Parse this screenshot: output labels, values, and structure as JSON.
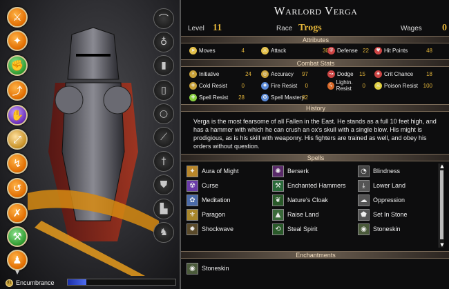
{
  "hero": {
    "name": "Warlord Verga",
    "level_label": "Level",
    "level": "11",
    "race_label": "Race",
    "race": "Trogs",
    "wages_label": "Wages",
    "wages": "0"
  },
  "sections": {
    "attributes": "Attributes",
    "combat": "Combat Stats",
    "history": "History",
    "spells": "Spells",
    "enchantments": "Enchantments"
  },
  "attributes": [
    {
      "label": "Moves",
      "value": "4"
    },
    {
      "label": "Attack",
      "value": "30"
    },
    {
      "label": "Defense",
      "value": "22"
    },
    {
      "label": "Hit Points",
      "value": "48"
    }
  ],
  "combat": [
    {
      "label": "Initiative",
      "value": "24"
    },
    {
      "label": "Accuracy",
      "value": "97"
    },
    {
      "label": "Dodge",
      "value": "15"
    },
    {
      "label": "Crit Chance",
      "value": "18"
    },
    {
      "label": "Cold Resist",
      "value": "0"
    },
    {
      "label": "Fire Resist",
      "value": "0"
    },
    {
      "label": "Lightn. Resist",
      "value": "0"
    },
    {
      "label": "Poison Resist",
      "value": "100"
    },
    {
      "label": "Spell Resist",
      "value": "28"
    },
    {
      "label": "Spell Mastery",
      "value": "82"
    }
  ],
  "history": "Verga is the most fearsome of all Fallen in the East. He stands as a full 10 feet high, and has a hammer with which he can crush an ox's skull with a single blow. His might is prodigious, as is his skill with weaponry. His fighters are trained as well, and obey his orders without question.",
  "spells": [
    "Aura of Might",
    "Berserk",
    "Blindness",
    "Curse",
    "Enchanted Hammers",
    "Lower Land",
    "Meditation",
    "Nature's Cloak",
    "Oppression",
    "Paragon",
    "Raise Land",
    "Set In Stone",
    "Shockwave",
    "Steal Spirit",
    "Stoneskin"
  ],
  "enchantments": [
    "Stoneskin"
  ],
  "encumbrance": {
    "label": "Encumbrance",
    "fill_fraction": 0.17,
    "coin": "91"
  },
  "colors": {
    "gold": "#e3b53a",
    "panel": "#0d0d0e",
    "header": "#6b5e50",
    "enc_bar": "#3a55e0"
  },
  "icons": {
    "abilities": [
      "crossed-swords-icon",
      "sword-arm-icon",
      "fist-icon",
      "strength-arm-icon",
      "dark-arm-icon",
      "block-icon",
      "sword-strike-icon",
      "heal-arm-icon",
      "charge-icon",
      "hammer-icon",
      "armor-up-icon",
      "shield-icon"
    ],
    "equipment": [
      "horn-icon",
      "amulet-icon",
      "cloak-icon",
      "armor-icon",
      "ring-icon",
      "bow-icon",
      "sword-icon",
      "helmet-icon",
      "boots-icon",
      "horse-icon"
    ]
  }
}
